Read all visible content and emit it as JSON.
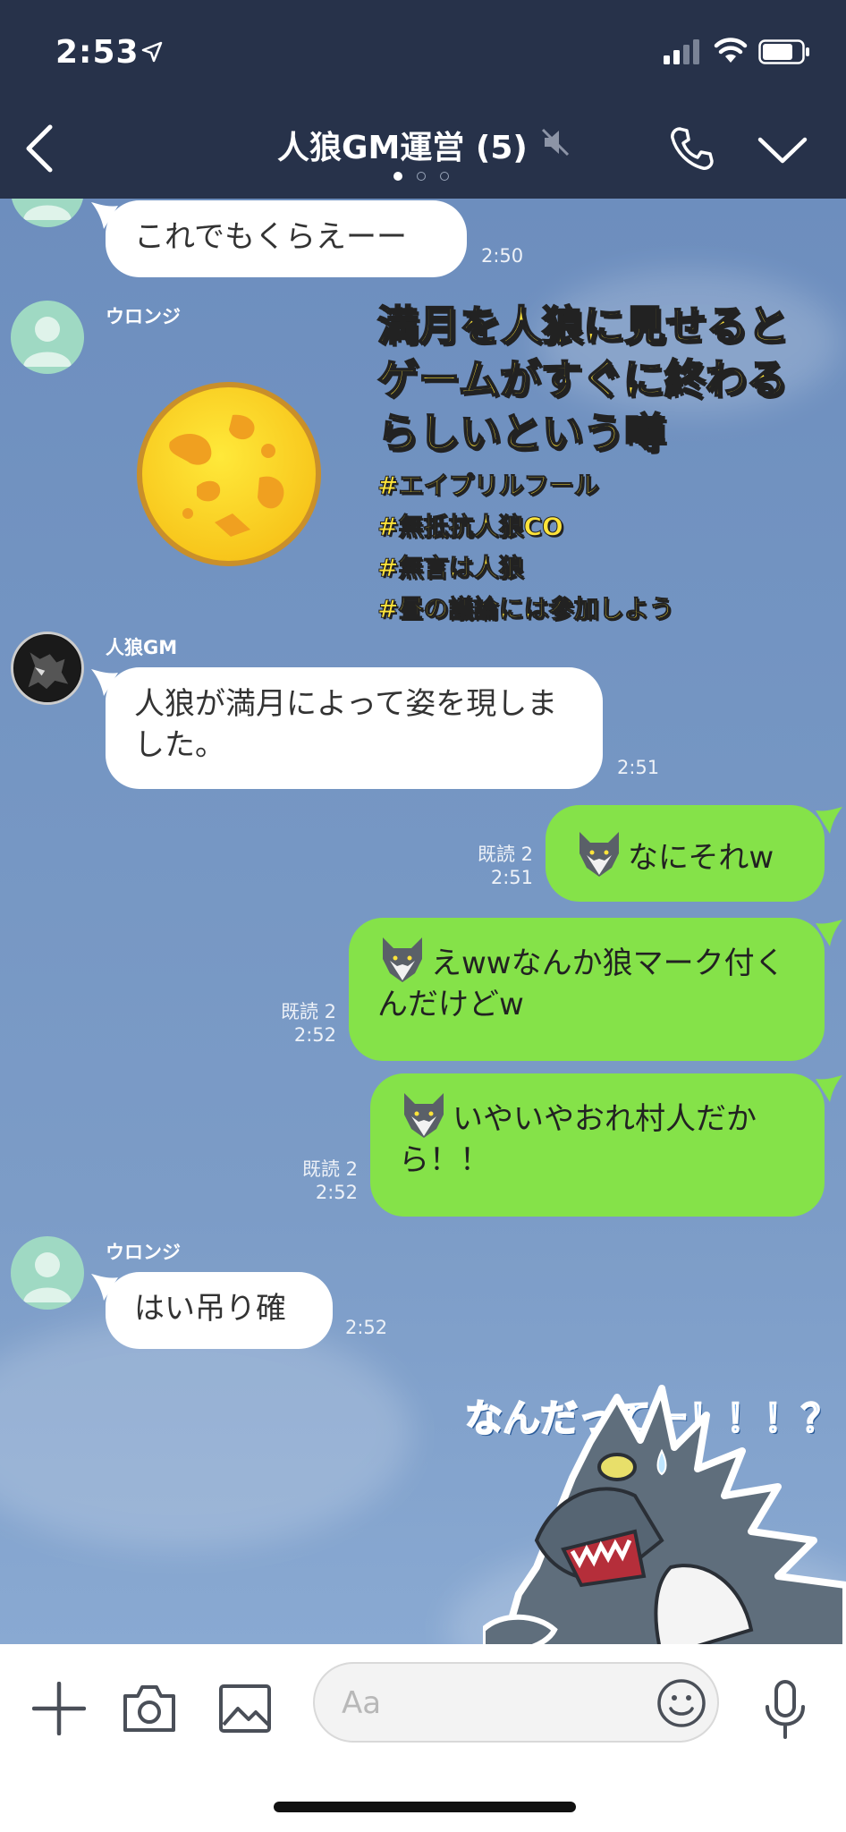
{
  "status": {
    "time": "2:53"
  },
  "header": {
    "title": "人狼GM運営 (5)"
  },
  "messages": [
    {
      "side": "left",
      "text": "これでもくらえーー",
      "time": "2:50"
    },
    {
      "side": "left",
      "sender": "ウロンジ",
      "sticker": "full-moon"
    },
    {
      "side": "left",
      "sender": "人狼GM",
      "text": "人狼が満月によって姿を現しました。",
      "time": "2:51"
    },
    {
      "side": "right",
      "text": "なにそれw",
      "read": "既読 2",
      "time": "2:51"
    },
    {
      "side": "right",
      "text": "えwwなんか狼マーク付くんだけどw",
      "read": "既読 2",
      "time": "2:52"
    },
    {
      "side": "right",
      "text": "いやいやおれ村人だから！！",
      "read": "既読 2",
      "time": "2:52"
    },
    {
      "side": "left",
      "sender": "ウロンジ",
      "text": "はい吊り確",
      "time": "2:52"
    },
    {
      "side": "left",
      "sticker": "surprised-wolf",
      "sticker_text": "なんだってー！！！？"
    }
  ],
  "overlay": {
    "headline": [
      "満月を人狼に見せると",
      "ゲームがすぐに終わる",
      "らしいという噂"
    ],
    "tags": [
      "#エイプリルフール",
      "#無抵抗人狼CO",
      "#無言は人狼",
      "#昼の議論には参加しよう"
    ]
  },
  "input": {
    "placeholder": "Aa"
  },
  "colors": {
    "header_bg": "#27324a",
    "sent_bubble": "#85e249",
    "chat_bg": "#7596c3",
    "overlay_text": "#ffe43a"
  }
}
